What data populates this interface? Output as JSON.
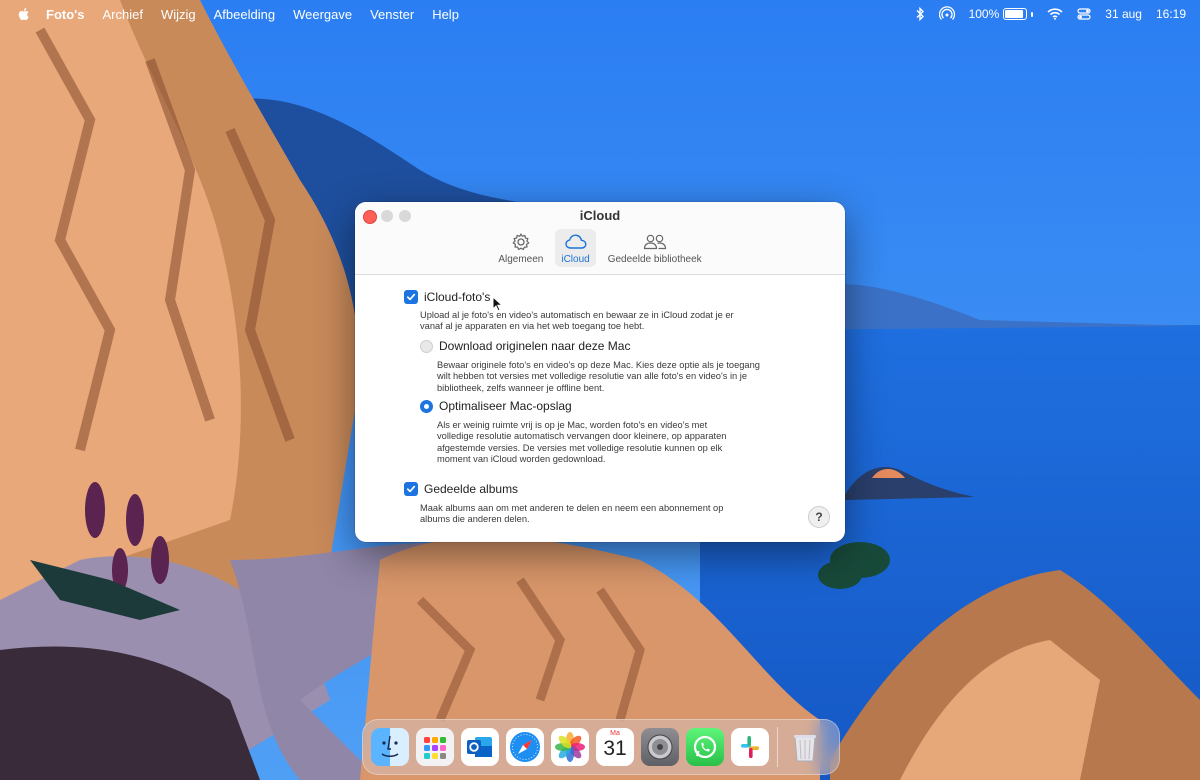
{
  "menubar": {
    "app_name": "Foto's",
    "items": [
      "Archief",
      "Wijzig",
      "Afbeelding",
      "Weergave",
      "Venster",
      "Help"
    ],
    "battery_percent": "100%",
    "battery_level": 1.0,
    "date": "31 aug",
    "time": "16:19"
  },
  "window": {
    "title": "iCloud",
    "tabs": [
      {
        "label": "Algemeen",
        "icon": "gear-icon",
        "active": false
      },
      {
        "label": "iCloud",
        "icon": "cloud-icon",
        "active": true
      },
      {
        "label": "Gedeelde bibliotheek",
        "icon": "people-icon",
        "active": false
      }
    ],
    "icloud_photos": {
      "label": "iCloud-foto's",
      "checked": true,
      "description_lines": [
        "Upload al je foto's en video's automatisch en bewaar ze in iCloud zodat je er",
        "vanaf al je apparaten en via het web toegang toe hebt."
      ]
    },
    "download_originals": {
      "label": "Download originelen naar deze Mac",
      "selected": false,
      "description_lines": [
        "Bewaar originele foto's en video's op deze Mac. Kies deze optie als je toegang",
        "wilt hebben tot versies met volledige resolutie van alle foto's en video's in je",
        "bibliotheek, zelfs wanneer je offline bent."
      ]
    },
    "optimize_storage": {
      "label": "Optimaliseer Mac-opslag",
      "selected": true,
      "description_lines": [
        "Als er weinig ruimte vrij is op je Mac, worden foto's en video's met",
        "volledige resolutie automatisch vervangen door kleinere, op apparaten",
        "afgestemde versies. De versies met volledige resolutie kunnen op elk",
        "moment van iCloud worden gedownload."
      ]
    },
    "shared_albums": {
      "label": "Gedeelde albums",
      "checked": true,
      "description_lines": [
        "Maak albums aan om met anderen te delen en neem een abonnement op",
        "albums die anderen delen."
      ]
    },
    "help_label": "?"
  },
  "dock": {
    "apps": [
      "Finder",
      "Launchpad",
      "Outlook",
      "Safari",
      "Foto's",
      "Agenda",
      "Systeeminstellingen",
      "WhatsApp",
      "Slack",
      "Prullenmand"
    ],
    "calendar_month": "Ma",
    "calendar_day": "31"
  }
}
